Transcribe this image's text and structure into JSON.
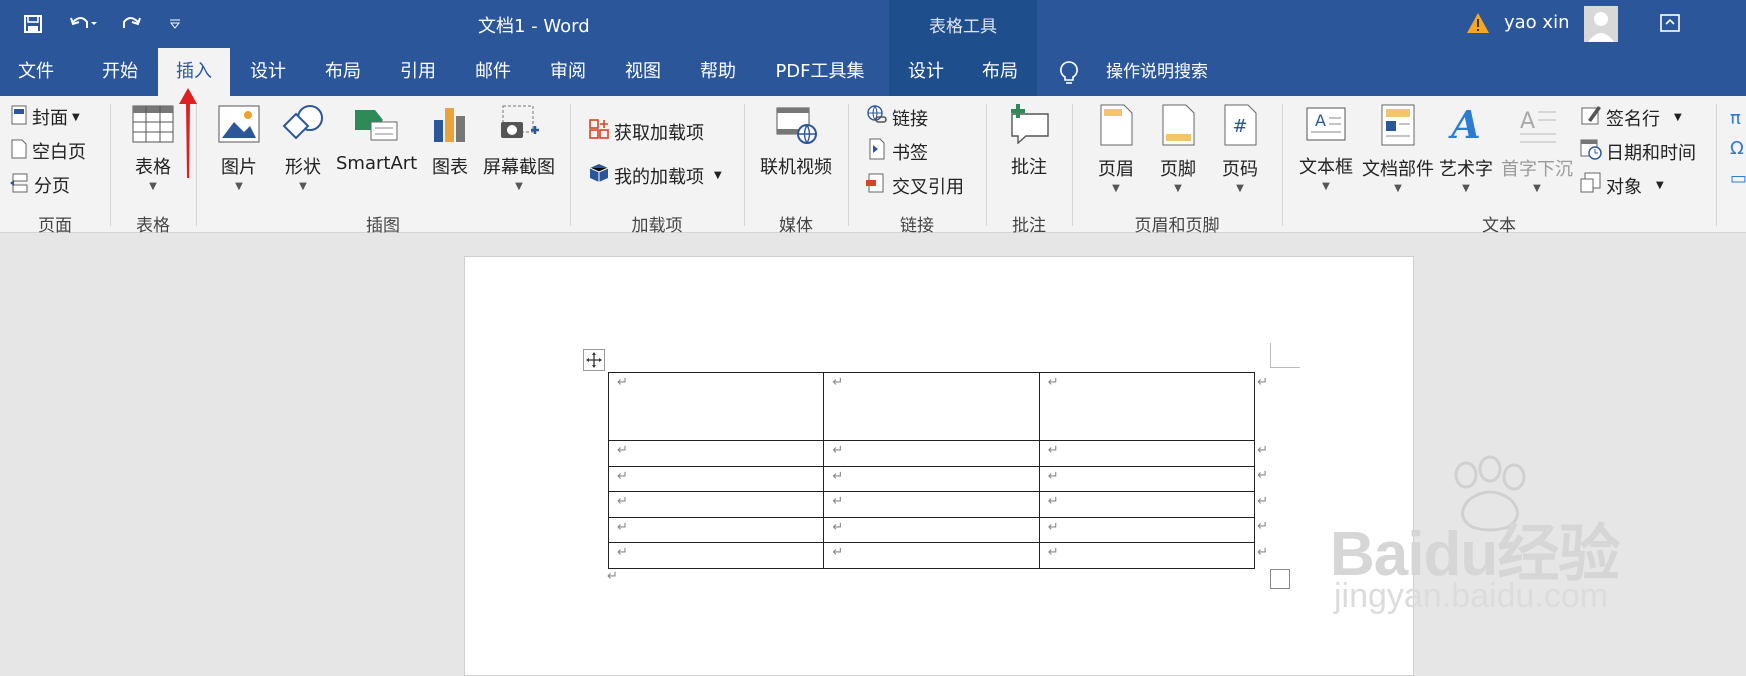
{
  "titlebar": {
    "document_title": "文档1  -  Word",
    "context_tool_title": "表格工具",
    "user_name": "yao xin",
    "icons": [
      "save-icon",
      "undo-icon",
      "redo-icon",
      "customize-qat-icon",
      "warning-icon",
      "avatar",
      "ribbon-display-icon"
    ]
  },
  "tabs": [
    {
      "label": "文件"
    },
    {
      "label": "开始"
    },
    {
      "label": "插入"
    },
    {
      "label": "设计"
    },
    {
      "label": "布局"
    },
    {
      "label": "引用"
    },
    {
      "label": "邮件"
    },
    {
      "label": "审阅"
    },
    {
      "label": "视图"
    },
    {
      "label": "帮助"
    },
    {
      "label": "PDF工具集"
    },
    {
      "label": "设计"
    },
    {
      "label": "布局"
    }
  ],
  "active_tab": "插入",
  "tell_me": "操作说明搜索",
  "groups": {
    "page": {
      "label": "页面",
      "cover": "封面",
      "blank": "空白页",
      "break": "分页"
    },
    "table": {
      "label": "表格",
      "table": "表格"
    },
    "illustrations": {
      "label": "插图",
      "picture": "图片",
      "shapes": "形状",
      "smartart": "SmartArt",
      "chart": "图表",
      "screenshot": "屏幕截图"
    },
    "addins": {
      "label": "加载项",
      "get": "获取加载项",
      "my": "我的加载项"
    },
    "media": {
      "label": "媒体",
      "video": "联机视频"
    },
    "links": {
      "label": "链接",
      "link": "链接",
      "bookmark": "书签",
      "crossref": "交叉引用"
    },
    "comments": {
      "label": "批注",
      "comment": "批注"
    },
    "headerfooter": {
      "label": "页眉和页脚",
      "header": "页眉",
      "footer": "页脚",
      "pagenum": "页码"
    },
    "text": {
      "label": "文本",
      "textbox": "文本框",
      "parts": "文档部件",
      "wordart": "艺术字",
      "dropcap": "首字下沉",
      "signature": "签名行",
      "datetime": "日期和时间",
      "object": "对象"
    }
  },
  "document": {
    "paragraph_mark": "↵",
    "table_rows": 6,
    "table_cols": 3
  },
  "watermark": {
    "brand": "Baidu经验",
    "url": "jingyan.baidu.com"
  },
  "colors": {
    "accent": "#2b579a",
    "context": "#1f4e8d",
    "arrow": "#e02020"
  }
}
